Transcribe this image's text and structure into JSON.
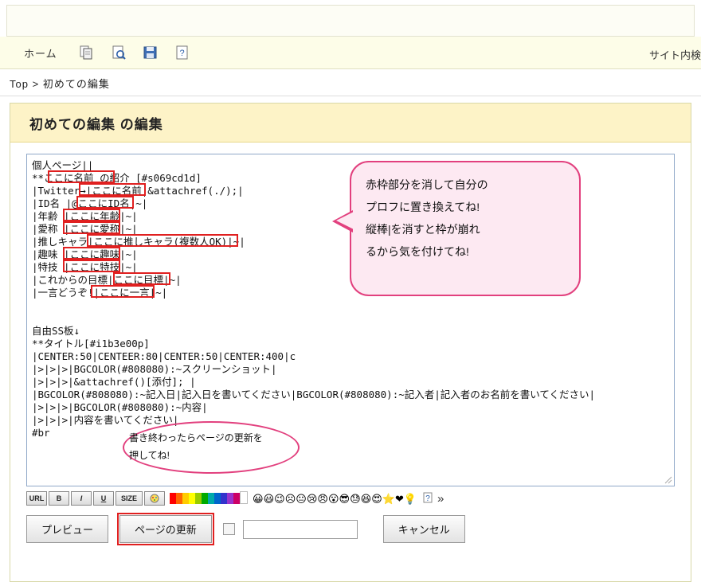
{
  "toolbar": {
    "home_label": "ホーム",
    "site_search_label": "サイト内検",
    "icons": [
      "copy-icon",
      "preview-icon",
      "save-icon",
      "help-icon"
    ]
  },
  "breadcrumb": {
    "root": "Top",
    "separator": ">",
    "current": "初めての編集"
  },
  "page": {
    "title": "初めての編集 の編集"
  },
  "editor": {
    "lines": [
      "個人ページ||",
      "**ここに名前 の紹介 [#s069cd1d]",
      "|Twitter→|ここに名前|&attachref(./);|",
      "|ID名 |@ここにID名|~|",
      "|年齢 |ここに年齢|~|",
      "|愛称 |ここに愛称|~|",
      "|推しキャラ|ここに推しキャラ(複数人OK)|~|",
      "|趣味 |ここに趣味|~|",
      "|特技 |ここに特技|~|",
      "|これからの目標|ここに目標|~|",
      "|一言どうぞ!|ここに一言|~|",
      "",
      "",
      "自由SS板↓",
      "**タイトル[#i1b3e00p]",
      "|CENTER:50|CENTEER:80|CENTER:50|CENTER:400|c",
      "|>|>|>|BGCOLOR(#808080):~スクリーンショット|",
      "|>|>|>|&attachref()[添付]; |",
      "|BGCOLOR(#808080):~記入日|記入日を書いてください|BGCOLOR(#808080):~記入者|記入者のお名前を書いてください|",
      "|>|>|>|BGCOLOR(#808080):~内容|",
      "|>|>|>|内容を書いてください|",
      "#br"
    ]
  },
  "balloon": {
    "lines": [
      "赤枠部分を消して自分の",
      "プロフに置き換えてね!",
      "縦棒|を消すと枠が崩れ",
      "るから気を付けてね!"
    ]
  },
  "oval_note": {
    "lines": [
      "書き終わったらページの更新を",
      "押してね!"
    ]
  },
  "format_bar": {
    "buttons": [
      "URL",
      "B",
      "I",
      "U",
      "SIZE",
      "color-icon"
    ],
    "emoji_count": 20,
    "more_label": "»"
  },
  "buttons": {
    "preview": "プレビュー",
    "update": "ページの更新",
    "cancel": "キャンセル"
  },
  "input": {
    "value": "",
    "placeholder": ""
  },
  "colors": {
    "highlight_red": "#e02020",
    "balloon_border": "#e2407e",
    "balloon_fill": "#fde9f2",
    "title_bg": "#fdf3c7",
    "toolbar_bg": "#fdfde8"
  }
}
